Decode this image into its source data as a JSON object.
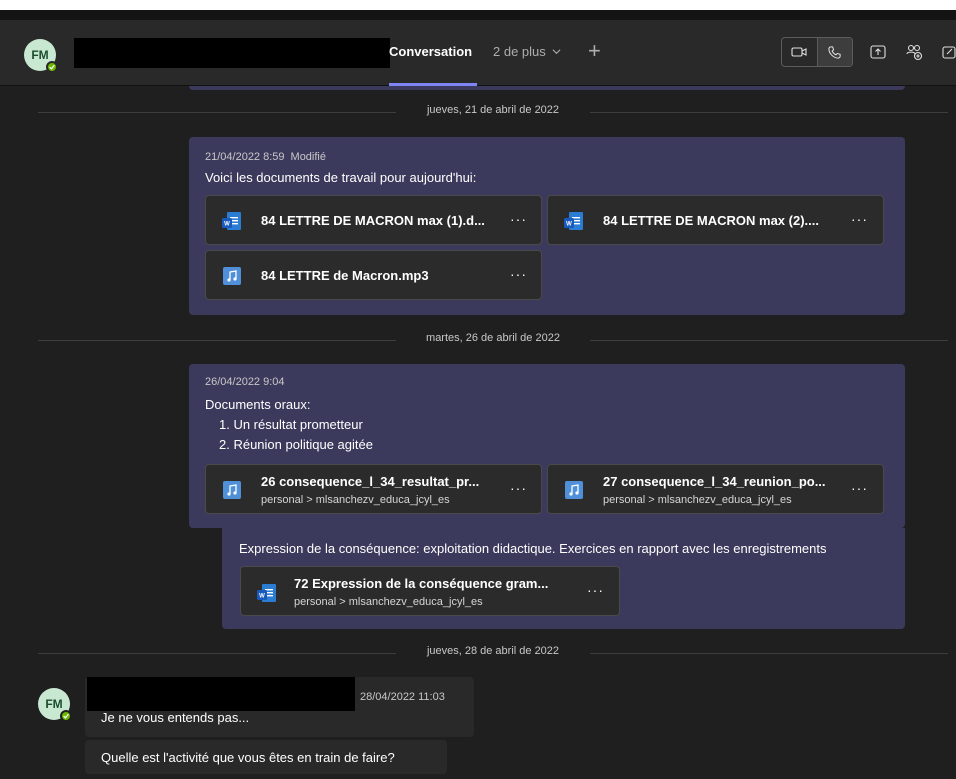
{
  "header": {
    "avatar_initials": "FM",
    "tab_active": "Conversation",
    "tab_more": "2 de plus",
    "tab_add": "+"
  },
  "dividers": [
    "jueves, 21 de abril de 2022",
    "martes, 26 de abril de 2022",
    "jueves, 28 de abril de 2022"
  ],
  "messages": [
    {
      "timestamp": "21/04/2022 8:59",
      "edited": "Modifié",
      "text": "Voici les documents de travail pour aujourd'hui:",
      "files": [
        {
          "name": "84 LETTRE DE MACRON max (1).d...",
          "icon": "word-doc-icon",
          "more": "···"
        },
        {
          "name": "84 LETTRE DE MACRON max (2)....",
          "icon": "word-doc-icon",
          "more": "···"
        },
        {
          "name": "84 LETTRE de Macron.mp3",
          "icon": "audio-file-icon",
          "more": "···"
        }
      ]
    },
    {
      "timestamp": "26/04/2022 9:04",
      "text": "Documents oraux:",
      "list": [
        "1. Un résultat prometteur",
        "2. Réunion politique agitée"
      ],
      "files": [
        {
          "name": "26 consequence_l_34_resultat_pr...",
          "path": "personal > mlsanchezv_educa_jcyl_es",
          "icon": "audio-file-icon",
          "more": "···"
        },
        {
          "name": "27 consequence_l_34_reunion_po...",
          "path": "personal > mlsanchezv_educa_jcyl_es",
          "icon": "audio-file-icon",
          "more": "···"
        }
      ],
      "followup": {
        "text": "Expression de la conséquence: exploitation didactique. Exercices en rapport avec les enregistrements",
        "file": {
          "name": "72 Expression de la conséquence gram...",
          "path": "personal > mlsanchezv_educa_jcyl_es",
          "icon": "word-doc-icon",
          "more": "···"
        }
      }
    }
  ],
  "reply": {
    "avatar_initials": "FM",
    "timestamp": "28/04/2022 11:03",
    "lines": [
      "Je ne vous entends pas...",
      "Quelle est l'activité que vous êtes en train de faire?"
    ]
  },
  "colors": {
    "background": "#1f1f1f",
    "header": "#292929",
    "own_message": "#3b3a5c",
    "accent": "#7f85f5",
    "presence_available": "#6bb700",
    "word_blue": "#185abd",
    "audio_blue": "#4f90d9"
  }
}
